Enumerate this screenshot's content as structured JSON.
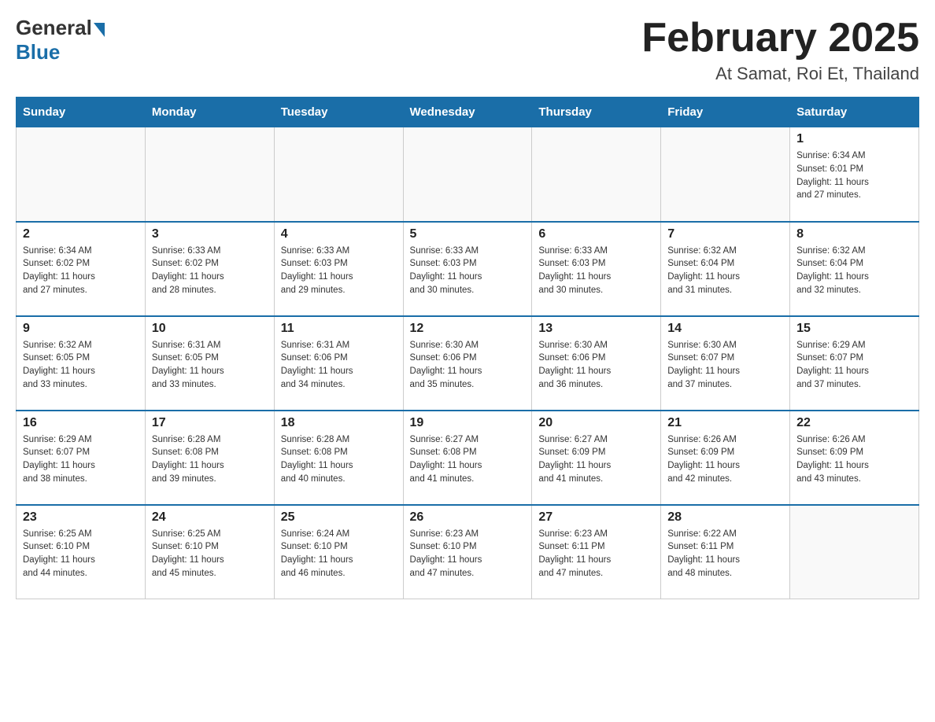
{
  "header": {
    "logo_general": "General",
    "logo_blue": "Blue",
    "month_title": "February 2025",
    "location": "At Samat, Roi Et, Thailand"
  },
  "weekdays": [
    "Sunday",
    "Monday",
    "Tuesday",
    "Wednesday",
    "Thursday",
    "Friday",
    "Saturday"
  ],
  "weeks": [
    [
      {
        "day": "",
        "info": ""
      },
      {
        "day": "",
        "info": ""
      },
      {
        "day": "",
        "info": ""
      },
      {
        "day": "",
        "info": ""
      },
      {
        "day": "",
        "info": ""
      },
      {
        "day": "",
        "info": ""
      },
      {
        "day": "1",
        "info": "Sunrise: 6:34 AM\nSunset: 6:01 PM\nDaylight: 11 hours\nand 27 minutes."
      }
    ],
    [
      {
        "day": "2",
        "info": "Sunrise: 6:34 AM\nSunset: 6:02 PM\nDaylight: 11 hours\nand 27 minutes."
      },
      {
        "day": "3",
        "info": "Sunrise: 6:33 AM\nSunset: 6:02 PM\nDaylight: 11 hours\nand 28 minutes."
      },
      {
        "day": "4",
        "info": "Sunrise: 6:33 AM\nSunset: 6:03 PM\nDaylight: 11 hours\nand 29 minutes."
      },
      {
        "day": "5",
        "info": "Sunrise: 6:33 AM\nSunset: 6:03 PM\nDaylight: 11 hours\nand 30 minutes."
      },
      {
        "day": "6",
        "info": "Sunrise: 6:33 AM\nSunset: 6:03 PM\nDaylight: 11 hours\nand 30 minutes."
      },
      {
        "day": "7",
        "info": "Sunrise: 6:32 AM\nSunset: 6:04 PM\nDaylight: 11 hours\nand 31 minutes."
      },
      {
        "day": "8",
        "info": "Sunrise: 6:32 AM\nSunset: 6:04 PM\nDaylight: 11 hours\nand 32 minutes."
      }
    ],
    [
      {
        "day": "9",
        "info": "Sunrise: 6:32 AM\nSunset: 6:05 PM\nDaylight: 11 hours\nand 33 minutes."
      },
      {
        "day": "10",
        "info": "Sunrise: 6:31 AM\nSunset: 6:05 PM\nDaylight: 11 hours\nand 33 minutes."
      },
      {
        "day": "11",
        "info": "Sunrise: 6:31 AM\nSunset: 6:06 PM\nDaylight: 11 hours\nand 34 minutes."
      },
      {
        "day": "12",
        "info": "Sunrise: 6:30 AM\nSunset: 6:06 PM\nDaylight: 11 hours\nand 35 minutes."
      },
      {
        "day": "13",
        "info": "Sunrise: 6:30 AM\nSunset: 6:06 PM\nDaylight: 11 hours\nand 36 minutes."
      },
      {
        "day": "14",
        "info": "Sunrise: 6:30 AM\nSunset: 6:07 PM\nDaylight: 11 hours\nand 37 minutes."
      },
      {
        "day": "15",
        "info": "Sunrise: 6:29 AM\nSunset: 6:07 PM\nDaylight: 11 hours\nand 37 minutes."
      }
    ],
    [
      {
        "day": "16",
        "info": "Sunrise: 6:29 AM\nSunset: 6:07 PM\nDaylight: 11 hours\nand 38 minutes."
      },
      {
        "day": "17",
        "info": "Sunrise: 6:28 AM\nSunset: 6:08 PM\nDaylight: 11 hours\nand 39 minutes."
      },
      {
        "day": "18",
        "info": "Sunrise: 6:28 AM\nSunset: 6:08 PM\nDaylight: 11 hours\nand 40 minutes."
      },
      {
        "day": "19",
        "info": "Sunrise: 6:27 AM\nSunset: 6:08 PM\nDaylight: 11 hours\nand 41 minutes."
      },
      {
        "day": "20",
        "info": "Sunrise: 6:27 AM\nSunset: 6:09 PM\nDaylight: 11 hours\nand 41 minutes."
      },
      {
        "day": "21",
        "info": "Sunrise: 6:26 AM\nSunset: 6:09 PM\nDaylight: 11 hours\nand 42 minutes."
      },
      {
        "day": "22",
        "info": "Sunrise: 6:26 AM\nSunset: 6:09 PM\nDaylight: 11 hours\nand 43 minutes."
      }
    ],
    [
      {
        "day": "23",
        "info": "Sunrise: 6:25 AM\nSunset: 6:10 PM\nDaylight: 11 hours\nand 44 minutes."
      },
      {
        "day": "24",
        "info": "Sunrise: 6:25 AM\nSunset: 6:10 PM\nDaylight: 11 hours\nand 45 minutes."
      },
      {
        "day": "25",
        "info": "Sunrise: 6:24 AM\nSunset: 6:10 PM\nDaylight: 11 hours\nand 46 minutes."
      },
      {
        "day": "26",
        "info": "Sunrise: 6:23 AM\nSunset: 6:10 PM\nDaylight: 11 hours\nand 47 minutes."
      },
      {
        "day": "27",
        "info": "Sunrise: 6:23 AM\nSunset: 6:11 PM\nDaylight: 11 hours\nand 47 minutes."
      },
      {
        "day": "28",
        "info": "Sunrise: 6:22 AM\nSunset: 6:11 PM\nDaylight: 11 hours\nand 48 minutes."
      },
      {
        "day": "",
        "info": ""
      }
    ]
  ]
}
